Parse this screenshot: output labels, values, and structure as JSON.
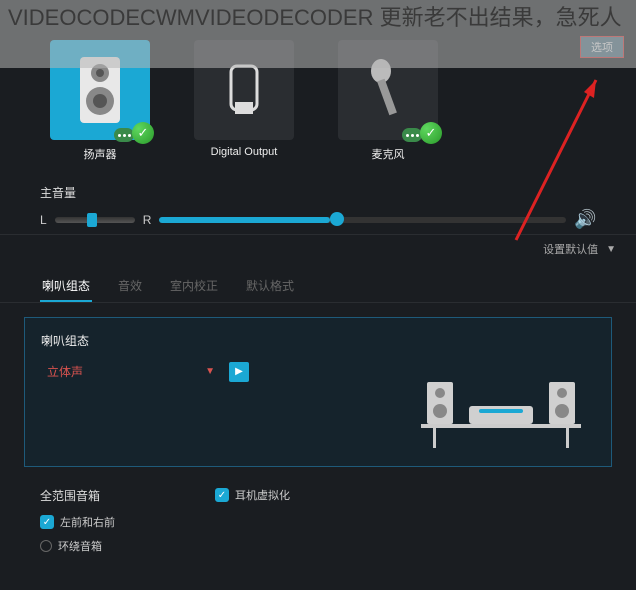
{
  "watermark": "VIDEOCODECWMVIDEODECODER 更新老不出结果，急死人",
  "top_right": {
    "options_label": "选项"
  },
  "devices": [
    {
      "label": "扬声器",
      "selected": true
    },
    {
      "label": "Digital Output",
      "selected": false
    },
    {
      "label": "麦克风",
      "selected": false
    }
  ],
  "volume": {
    "title": "主音量",
    "left_label": "L",
    "right_label": "R"
  },
  "defaults_label": "设置默认值",
  "tabs": [
    {
      "label": "喇叭组态",
      "active": true
    },
    {
      "label": "音效",
      "active": false
    },
    {
      "label": "室内校正",
      "active": false
    },
    {
      "label": "默认格式",
      "active": false
    }
  ],
  "config": {
    "title": "喇叭组态",
    "dropdown_value": "立体声"
  },
  "options": {
    "left_title": "全范围音箱",
    "left_items": [
      {
        "label": "左前和右前",
        "checked": true
      },
      {
        "label": "环绕音箱",
        "checked": false
      }
    ],
    "right_item": {
      "label": "耳机虚拟化",
      "checked": true
    }
  }
}
